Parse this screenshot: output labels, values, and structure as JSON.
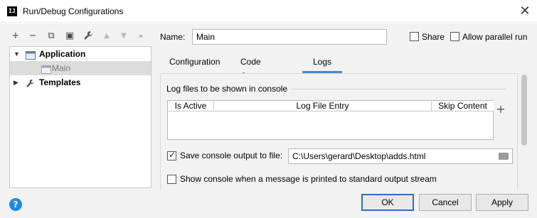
{
  "window": {
    "title": "Run/Debug Configurations",
    "app_icon_text": "IJ"
  },
  "toolbar": {
    "icons": [
      "add-icon",
      "remove-icon",
      "copy-icon",
      "save-icon",
      "wrench-icon",
      "move-up-icon",
      "move-down-icon",
      "more-icon"
    ],
    "glyphs": {
      "add": "+",
      "remove": "−",
      "copy": "⧉",
      "save": "▣",
      "wrench": "🔧",
      "up": "▲",
      "down": "▼",
      "more": "»"
    }
  },
  "tree": {
    "items": [
      {
        "label": "Application",
        "bold": true,
        "expanded": true
      },
      {
        "label": "Main",
        "bold": false,
        "selected": true
      },
      {
        "label": "Templates",
        "bold": true,
        "expanded": false
      }
    ]
  },
  "name_field": {
    "label": "Name:",
    "value": "Main"
  },
  "options": {
    "share": {
      "label": "Share",
      "checked": false
    },
    "allow_parallel": {
      "label": "Allow parallel run",
      "checked": false
    }
  },
  "tabs": [
    {
      "label": "Configuration",
      "active": false
    },
    {
      "label": "Code Coverage",
      "active": false
    },
    {
      "label": "Logs",
      "active": true
    }
  ],
  "logs": {
    "section_title": "Log files to be shown in console",
    "table": {
      "columns": [
        "Is Active",
        "Log File Entry",
        "Skip Content"
      ],
      "rows": []
    },
    "save_to_file": {
      "label": "Save console output to file:",
      "checked": true,
      "path": "C:\\Users\\gerard\\Desktop\\adds.html"
    },
    "show_stdout": {
      "label": "Show console when a message is printed to standard output stream",
      "checked": false
    }
  },
  "buttons": {
    "help": "?",
    "ok": "OK",
    "cancel": "Cancel",
    "apply": "Apply"
  },
  "colors": {
    "accent": "#4a88c7",
    "help": "#1e88e5",
    "dialog_bg": "#f2f2f2"
  }
}
